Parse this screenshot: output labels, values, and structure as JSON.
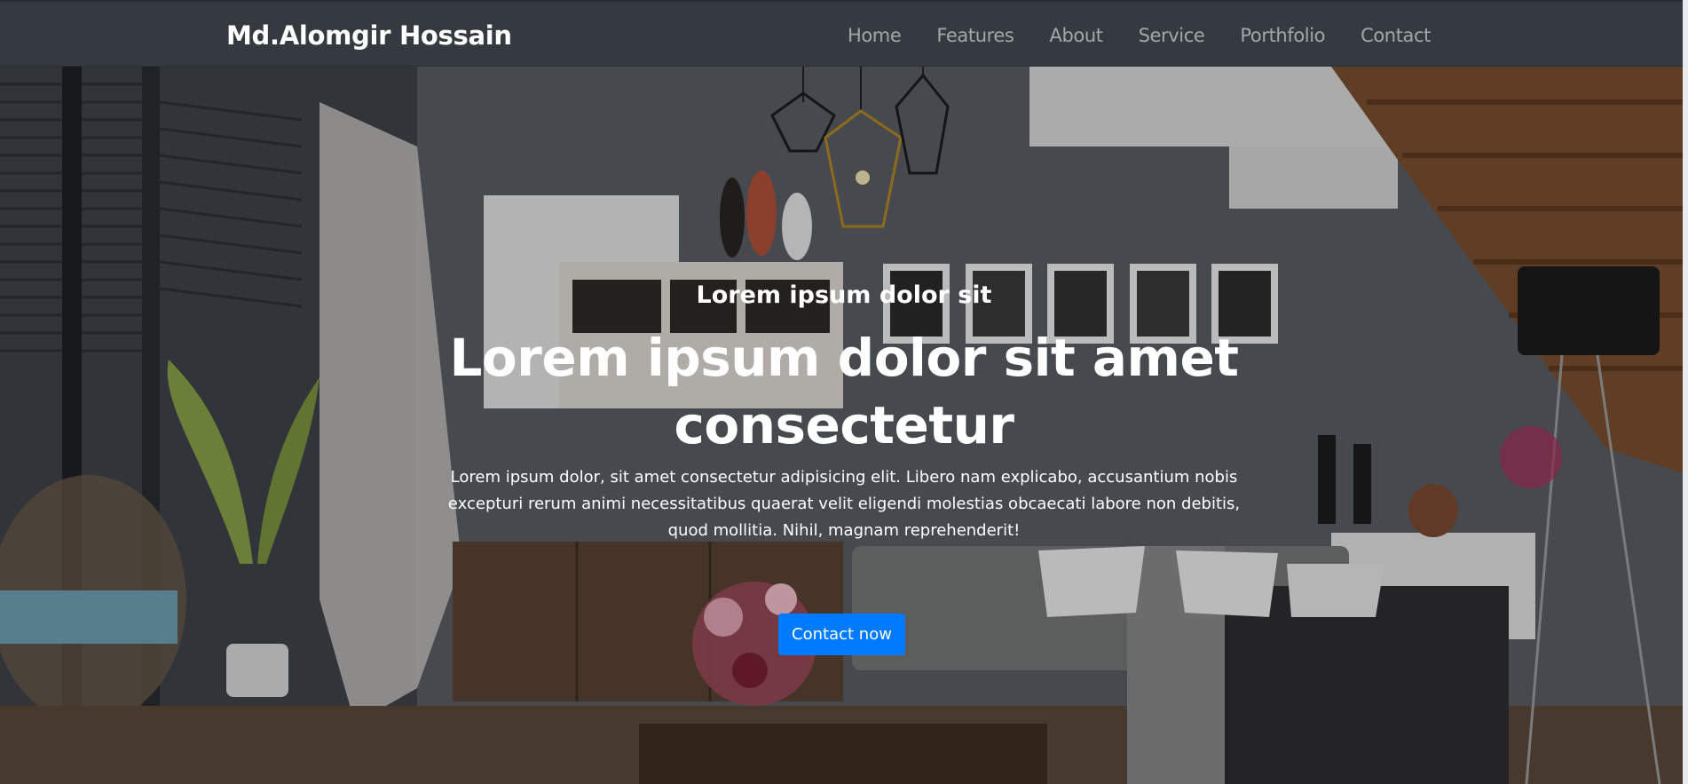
{
  "navbar": {
    "brand": "Md.Alomgir Hossain",
    "links": [
      {
        "label": "Home"
      },
      {
        "label": "Features"
      },
      {
        "label": "About"
      },
      {
        "label": "Service"
      },
      {
        "label": "Porthfolio"
      },
      {
        "label": "Contact"
      }
    ]
  },
  "hero": {
    "eyebrow": "Lorem ipsum dolor sit",
    "headline": "Lorem ipsum dolor sit amet consectetur",
    "lead": "Lorem ipsum dolor, sit amet consectetur adipisicing elit. Libero nam explicabo, accusantium nobis excepturi rerum animi necessitatibus quaerat velit eligendi molestias obcaecati labore non debitis, quod mollitia. Nihil, magnam reprehenderit!",
    "cta_label": "Contact now",
    "background_image": "living-room-interior-photo"
  },
  "colors": {
    "navbar_bg": "#343a40",
    "nav_link": "rgba(255,255,255,0.55)",
    "cta_bg": "#007bff"
  }
}
